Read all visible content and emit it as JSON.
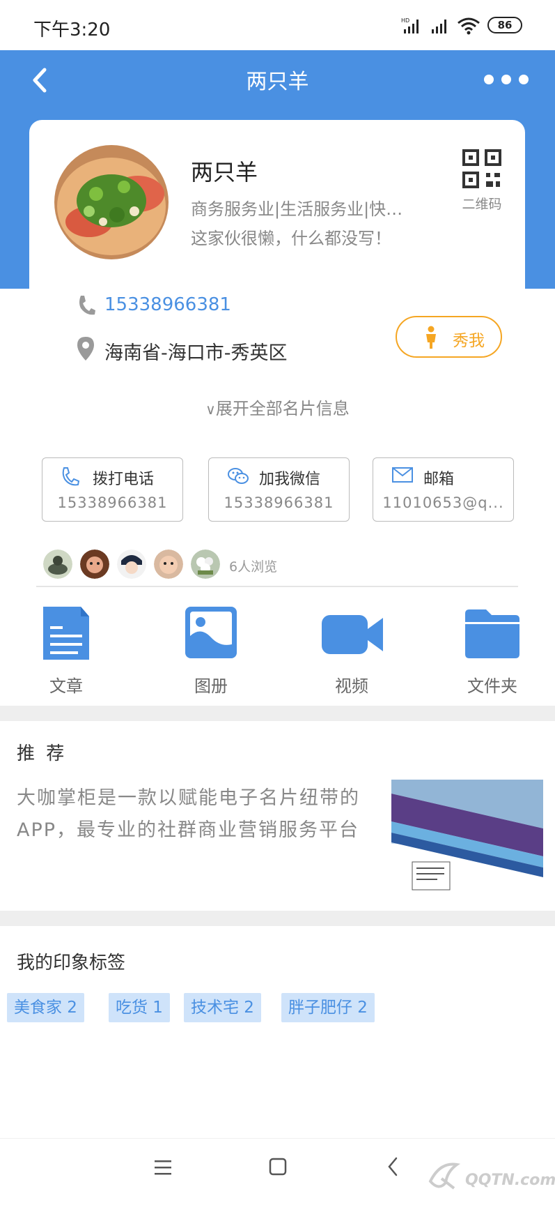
{
  "status_bar": {
    "time": "下午3:20",
    "network": "HD",
    "battery": "86"
  },
  "header": {
    "title": "两只羊"
  },
  "profile": {
    "name": "两只羊",
    "industry": "商务服务业|生活服务业|快…",
    "bio": "这家伙很懒，什么都没写！",
    "qr_label": "二维码",
    "phone": "15338966381",
    "location": "海南省-海口市-秀英区",
    "show_me": "秀我",
    "expand": "展开全部名片信息"
  },
  "contacts": [
    {
      "label": "拨打电话",
      "value": "15338966381",
      "icon": "phone-icon"
    },
    {
      "label": "加我微信",
      "value": "15338966381",
      "icon": "wechat-icon"
    },
    {
      "label": "邮箱",
      "value": "11010653@q...",
      "icon": "mail-icon"
    }
  ],
  "visitors": {
    "count_text": "6人浏览"
  },
  "features": [
    {
      "label": "文章",
      "icon": "article-icon"
    },
    {
      "label": "图册",
      "icon": "album-icon"
    },
    {
      "label": "视频",
      "icon": "video-icon"
    },
    {
      "label": "文件夹",
      "icon": "folder-icon"
    }
  ],
  "recommend": {
    "title": "推 荐",
    "text": "大咖掌柜是一款以赋能电子名片纽带的APP，最专业的社群商业营销服务平台"
  },
  "tags": {
    "title": "我的印象标签",
    "items": [
      {
        "label": "美食家 2"
      },
      {
        "label": "吃货 1"
      },
      {
        "label": "技术宅 2"
      },
      {
        "label": "胖子肥仔 2"
      }
    ]
  },
  "colors": {
    "primary": "#4a90e2",
    "accent": "#f5a623",
    "tag_bg": "#cfe3fa"
  }
}
